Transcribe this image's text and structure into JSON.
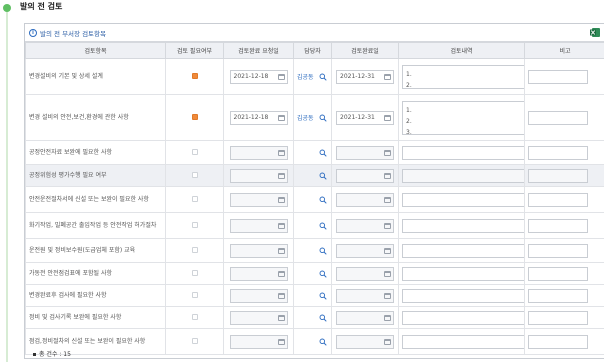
{
  "page": {
    "title": "발의 전 검토"
  },
  "panel": {
    "title": "발의 전 부서장 검토항목"
  },
  "columns": [
    "검토항목",
    "검토 필요여부",
    "검토완료 요청일",
    "담당자",
    "검토완료일",
    "검토내역",
    "비고"
  ],
  "rows": [
    {
      "item": "변경설비의 기본 및 상세 설계",
      "checked": true,
      "request_date": "2021-12-18",
      "assignee": "김공동",
      "complete_date": "2021-12-31",
      "review_lines": [
        "1.",
        "2."
      ],
      "highlight": false
    },
    {
      "item": "변경 설비의 안전,보건,환경에 관한 사항",
      "checked": true,
      "request_date": "2021-12-18",
      "assignee": "김공동",
      "complete_date": "2021-12-31",
      "review_lines": [
        "1.",
        "2.",
        "3."
      ],
      "highlight": false
    },
    {
      "item": "공정안전자료 보완에 필요한 사항",
      "checked": false,
      "request_date": "",
      "assignee": "",
      "complete_date": "",
      "review_lines": [],
      "highlight": false
    },
    {
      "item": "공정위험성 평가수행 필요 여부",
      "checked": false,
      "request_date": "",
      "assignee": "",
      "complete_date": "",
      "review_lines": [],
      "highlight": true
    },
    {
      "item": "안전운전절차서에 신설 또는 보완이 필요한 사항",
      "checked": false,
      "request_date": "",
      "assignee": "",
      "complete_date": "",
      "review_lines": [],
      "highlight": false
    },
    {
      "item": "화기작업, 밀폐공간 출입작업 등 안전작업 허가절차",
      "checked": false,
      "request_date": "",
      "assignee": "",
      "complete_date": "",
      "review_lines": [],
      "highlight": false
    },
    {
      "item": "운전원 및 정비보수원(도급업체 포함) 교육",
      "checked": false,
      "request_date": "",
      "assignee": "",
      "complete_date": "",
      "review_lines": [],
      "highlight": false
    },
    {
      "item": "가동전 안전점검표에 포함될 사항",
      "checked": false,
      "request_date": "",
      "assignee": "",
      "complete_date": "",
      "review_lines": [],
      "highlight": false
    },
    {
      "item": "변경완료후 검사에 필요한 사항",
      "checked": false,
      "request_date": "",
      "assignee": "",
      "complete_date": "",
      "review_lines": [],
      "highlight": false
    },
    {
      "item": "정비 및 검사기록 보완에 필요한 사항",
      "checked": false,
      "request_date": "",
      "assignee": "",
      "complete_date": "",
      "review_lines": [],
      "highlight": false
    },
    {
      "item": "점검,정비절차의 신설 또는 보완이 필요한 사항",
      "checked": false,
      "request_date": "",
      "assignee": "",
      "complete_date": "",
      "review_lines": [],
      "highlight": false
    }
  ],
  "footer": {
    "total": "총 건수 : 15"
  },
  "icons": {
    "status_dot": "green-dot-icon",
    "info": "info-icon",
    "excel": "excel-icon",
    "calendar": "calendar-icon",
    "search": "search-icon"
  }
}
